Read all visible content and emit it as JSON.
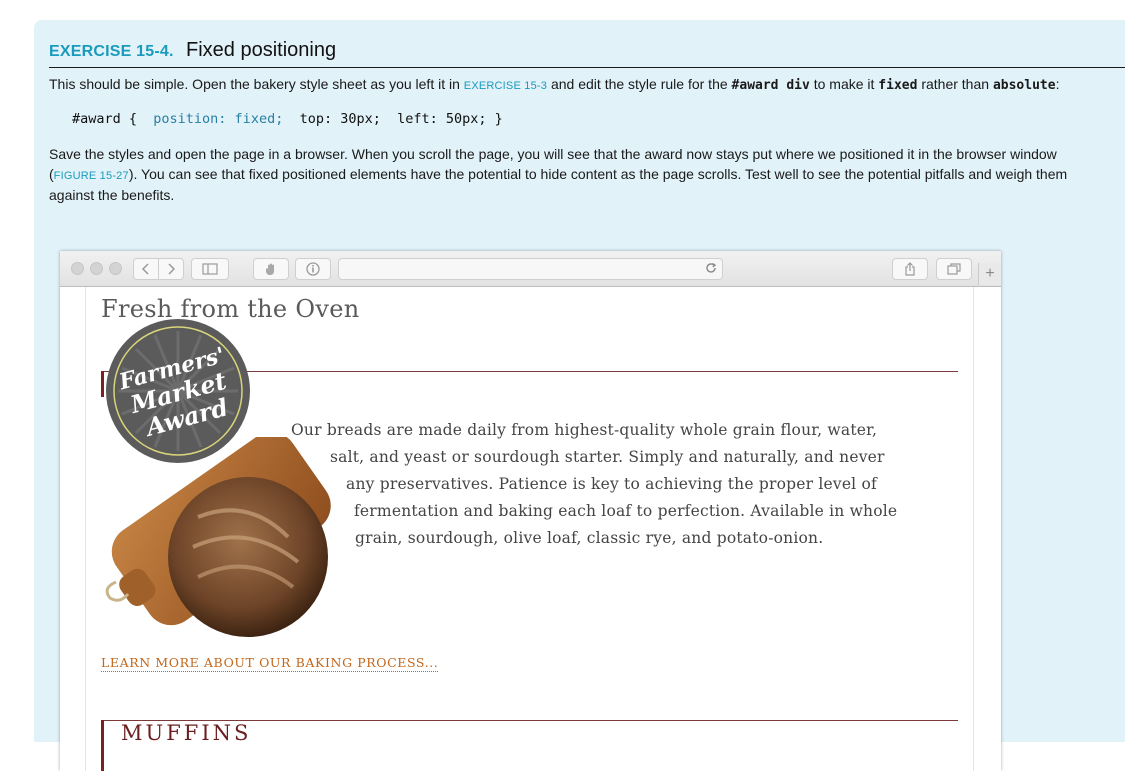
{
  "exercise": {
    "label": "EXERCISE 15-4.",
    "title": "Fixed positioning",
    "intro": {
      "before": "This should be simple. Open the bakery style sheet as you left it in ",
      "xref": "EXERCISE 15-3",
      "mid1": " and edit the style rule for the ",
      "code1": "#award div",
      "mid2": " to make it ",
      "code2": "fixed",
      "mid3": " rather than ",
      "code3": "absolute",
      "end": ":"
    },
    "code": {
      "start": "#award {  ",
      "highlight": "position: fixed;",
      "rest": "  top: 30px;  left: 50px; }"
    },
    "para2": {
      "line1": "Save the styles and open the page in a browser. When you scroll the page, you will see that the award now stays put where we positioned it in the browser window",
      "open_paren": "(",
      "xref": "FIGURE 15-27",
      "line2_rest": "). You can see that fixed positioned elements have the potential to hide content as the page scrolls. Test well to see the potential pitfalls and weigh them",
      "line3": "against the benefits."
    }
  },
  "browser": {
    "icons": [
      "back-icon",
      "forward-icon",
      "sidebar-icon",
      "hand-icon",
      "info-icon",
      "reload-icon",
      "share-icon",
      "tabs-icon",
      "plus-icon"
    ],
    "plus": "+"
  },
  "page": {
    "heading": "Fresh from the Oven",
    "award_text": [
      "Farmers'",
      "Market",
      "Award"
    ],
    "body_lines": [
      "Our breads are made daily from highest-quality whole grain flour, water,",
      "salt, and yeast or sourdough starter. Simply and naturally, and never",
      "any preservatives. Patience is key to achieving the proper level of",
      "fermentation and baking each loaf to perfection. Available in whole",
      "grain, sourdough, olive loaf, classic rye, and potato-onion."
    ],
    "link": "LEARN MORE ABOUT OUR BAKING PROCESS...",
    "section2": "MUFFINS"
  },
  "colors": {
    "panel": "#e1f2f9",
    "accent": "#1a9bbd",
    "link": "#c2671c",
    "rule": "#7a2020"
  }
}
